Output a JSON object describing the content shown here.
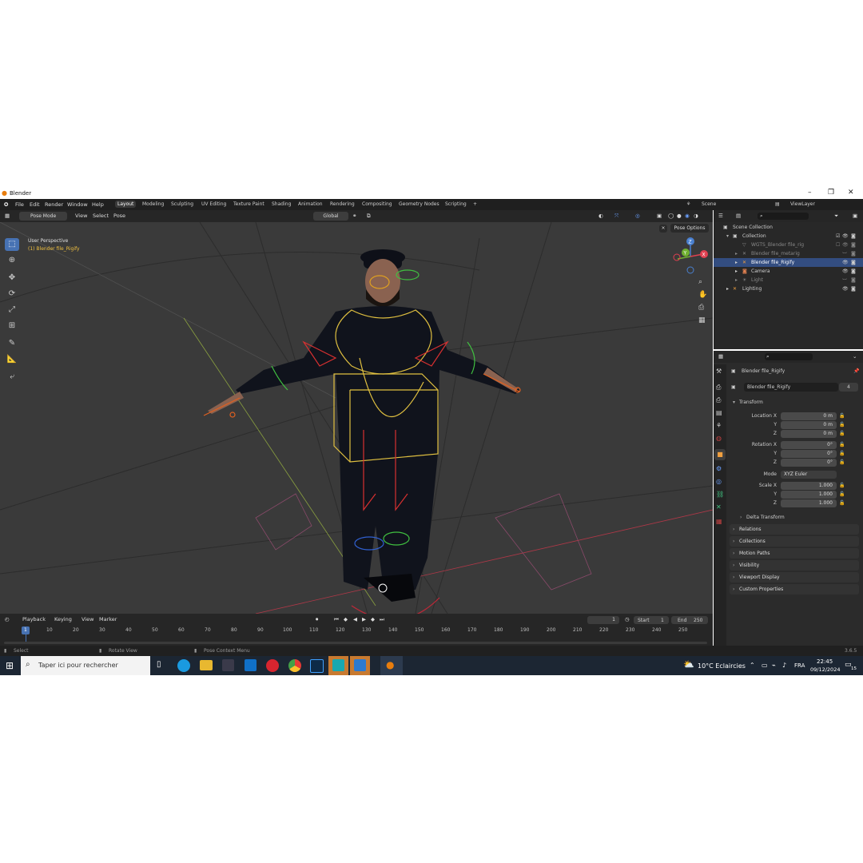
{
  "window": {
    "title": "Blender",
    "minimize": "–",
    "maximize": "❐",
    "close": "✕"
  },
  "menu": [
    "File",
    "Edit",
    "Render",
    "Window",
    "Help"
  ],
  "workspaces": [
    "Layout",
    "Modeling",
    "Sculpting",
    "UV Editing",
    "Texture Paint",
    "Shading",
    "Animation",
    "Rendering",
    "Compositing",
    "Geometry Nodes",
    "Scripting"
  ],
  "active_workspace": "Layout",
  "scene": {
    "name": "Scene",
    "view_layer": "ViewLayer"
  },
  "viewport_header": {
    "mode": "Pose Mode",
    "menus": [
      "View",
      "Select",
      "Pose"
    ],
    "orientation": "Global",
    "pose_options": "Pose Options"
  },
  "viewport": {
    "perspective_label": "User Perspective",
    "object_label": "(1) Blender file_Rigify",
    "gizmo_axes": {
      "x": "X",
      "y": "Y",
      "z": "Z"
    }
  },
  "outliner": {
    "root": "Scene Collection",
    "collection": "Collection",
    "items": [
      {
        "label": "WGTS_Blender file_rig",
        "dim": true
      },
      {
        "label": "Blender file_metarig",
        "dim": true
      },
      {
        "label": "Blender file_Rigify",
        "selected": true
      },
      {
        "label": "Camera",
        "dim": false
      },
      {
        "label": "Light",
        "dim": true
      },
      {
        "label": "Lighting",
        "dim": false
      }
    ]
  },
  "properties": {
    "object_name": "Blender file_Rigify",
    "data_name": "Blender file_Rigify",
    "users": "4",
    "transform_title": "Transform",
    "location": {
      "label": "Location X",
      "x": "0 m",
      "y": "0 m",
      "z": "0 m"
    },
    "rotation": {
      "label": "Rotation X",
      "x": "0°",
      "y": "0°",
      "z": "0°"
    },
    "mode_label": "Mode",
    "mode_value": "XYZ Euler",
    "scale": {
      "label": "Scale X",
      "x": "1.000",
      "y": "1.000",
      "z": "1.000"
    },
    "axis_y": "Y",
    "axis_z": "Z",
    "delta": "Delta Transform",
    "panels": [
      "Relations",
      "Collections",
      "Motion Paths",
      "Visibility",
      "Viewport Display",
      "Custom Properties"
    ]
  },
  "timeline": {
    "menus": [
      "Playback",
      "Keying",
      "View",
      "Marker"
    ],
    "current_frame": "1",
    "start_label": "Start",
    "start": "1",
    "end_label": "End",
    "end": "250",
    "ticks": [
      "10",
      "20",
      "30",
      "40",
      "50",
      "60",
      "70",
      "80",
      "90",
      "100",
      "110",
      "120",
      "130",
      "140",
      "150",
      "160",
      "170",
      "180",
      "190",
      "200",
      "210",
      "220",
      "230",
      "240",
      "250"
    ],
    "playhead": "1"
  },
  "statusbar": {
    "select": "Select",
    "rotate": "Rotate View",
    "context": "Pose Context Menu",
    "version": "3.6.5"
  },
  "taskbar": {
    "search_placeholder": "Taper ici pour rechercher",
    "weather": "10°C  Eclaircies",
    "lang": "FRA",
    "time": "22:45",
    "date": "09/12/2024",
    "notifications": "15"
  },
  "colors": {
    "accent": "#4772b3",
    "selected_row": "#334d80",
    "bone_yellow": "#e0c040",
    "bone_red": "#d83030",
    "axis_x": "#e04050",
    "axis_y": "#70b030",
    "axis_z": "#4a80d0"
  }
}
